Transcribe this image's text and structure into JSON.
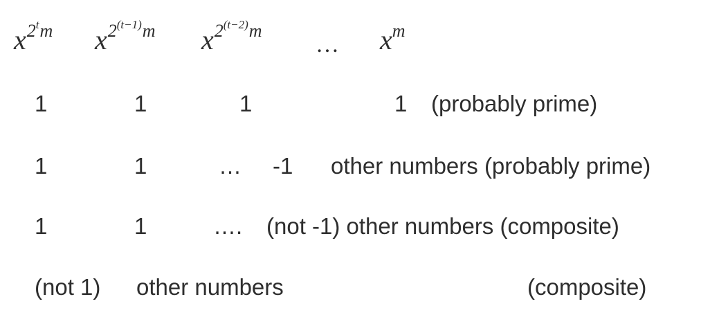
{
  "header": {
    "col1": {
      "base": "x",
      "exp": "2",
      "exp_sup": "t",
      "exp_tail": "m"
    },
    "col2": {
      "base": "x",
      "exp": "2",
      "exp_sup": "(t−1)",
      "exp_tail": "m"
    },
    "col3": {
      "base": "x",
      "exp": "2",
      "exp_sup": "(t−2)",
      "exp_tail": "m"
    },
    "ellipsis": "…",
    "col5": {
      "base": "x",
      "exp": "m"
    }
  },
  "rows": [
    {
      "c1": "1",
      "c2": "1",
      "c3": "1",
      "c4": "1",
      "result": "(probably prime)"
    },
    {
      "c1": "1",
      "c2": "1",
      "c3": "…",
      "c4": "-1",
      "result": "other numbers (probably prime)"
    },
    {
      "c1": "1",
      "c2": "1",
      "c3": "….",
      "c4": "(not -1) other numbers (composite)"
    },
    {
      "c1": "(not 1)",
      "c2": "other numbers",
      "result": "(composite)"
    }
  ]
}
